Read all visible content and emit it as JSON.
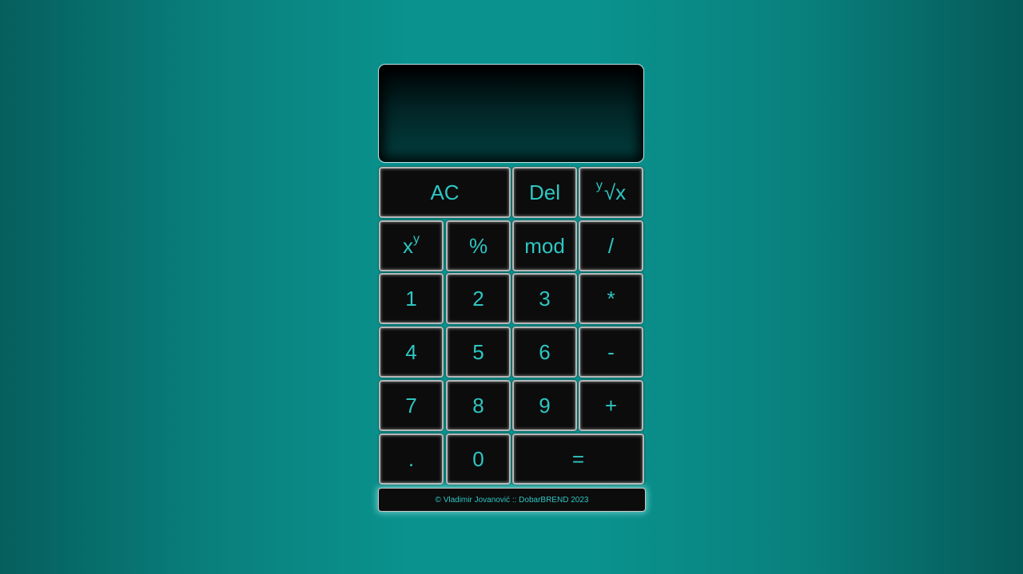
{
  "display": {
    "value": ""
  },
  "keys": {
    "ac": "AC",
    "del": "Del",
    "root_index": "y",
    "root_symbol": "√x",
    "pow_base": "x",
    "pow_exp": "y",
    "percent": "%",
    "mod": "mod",
    "divide": "/",
    "one": "1",
    "two": "2",
    "three": "3",
    "multiply": "*",
    "four": "4",
    "five": "5",
    "six": "6",
    "minus": "-",
    "seven": "7",
    "eight": "8",
    "nine": "9",
    "plus": "+",
    "dot": ".",
    "zero": "0",
    "equals": "="
  },
  "footer": {
    "text": "© Vladimir Jovanović :: DobarBREND 2023"
  },
  "colors": {
    "accent": "#2ec6c2",
    "key_background": "#0c0c0c",
    "page_background": "#0a928e"
  }
}
